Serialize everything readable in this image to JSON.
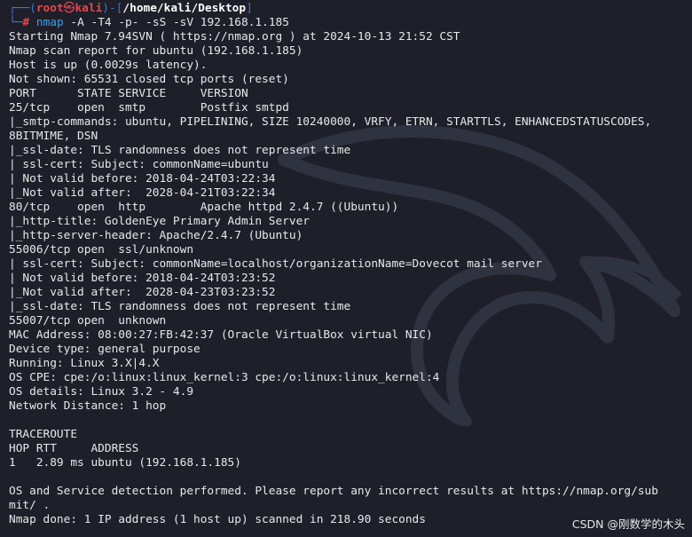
{
  "prompt": {
    "frame_top": "┌──(",
    "user": "root",
    "skull": "㉿",
    "host": "kali",
    "bracket_mid": ")-[",
    "path": "/home/kali/Desktop",
    "bracket_end": "]",
    "frame_bottom": "└─",
    "hash": "#",
    "command": "nmap",
    "args": "-A -T4 -p- -sS -sV 192.168.1.185"
  },
  "output_lines": [
    "Starting Nmap 7.94SVN ( https://nmap.org ) at 2024-10-13 21:52 CST",
    "Nmap scan report for ubuntu (192.168.1.185)",
    "Host is up (0.0029s latency).",
    "Not shown: 65531 closed tcp ports (reset)",
    "PORT      STATE SERVICE     VERSION",
    "25/tcp    open  smtp        Postfix smtpd",
    "|_smtp-commands: ubuntu, PIPELINING, SIZE 10240000, VRFY, ETRN, STARTTLS, ENHANCEDSTATUSCODES,",
    "8BITMIME, DSN",
    "|_ssl-date: TLS randomness does not represent time",
    "| ssl-cert: Subject: commonName=ubuntu",
    "| Not valid before: 2018-04-24T03:22:34",
    "|_Not valid after:  2028-04-21T03:22:34",
    "80/tcp    open  http        Apache httpd 2.4.7 ((Ubuntu))",
    "|_http-title: GoldenEye Primary Admin Server",
    "|_http-server-header: Apache/2.4.7 (Ubuntu)",
    "55006/tcp open  ssl/unknown",
    "| ssl-cert: Subject: commonName=localhost/organizationName=Dovecot mail server",
    "| Not valid before: 2018-04-24T03:23:52",
    "|_Not valid after:  2028-04-23T03:23:52",
    "|_ssl-date: TLS randomness does not represent time",
    "55007/tcp open  unknown",
    "MAC Address: 08:00:27:FB:42:37 (Oracle VirtualBox virtual NIC)",
    "Device type: general purpose",
    "Running: Linux 3.X|4.X",
    "OS CPE: cpe:/o:linux:linux_kernel:3 cpe:/o:linux:linux_kernel:4",
    "OS details: Linux 3.2 - 4.9",
    "Network Distance: 1 hop",
    "",
    "TRACEROUTE",
    "HOP RTT     ADDRESS",
    "1   2.89 ms ubuntu (192.168.1.185)",
    "",
    "OS and Service detection performed. Please report any incorrect results at https://nmap.org/sub",
    "mit/ .",
    "Nmap done: 1 IP address (1 host up) scanned in 218.90 seconds"
  ],
  "watermark": "CSDN @刚数学的木头",
  "colors": {
    "background": "#1e1f29",
    "text": "#e8e8ea",
    "prompt_frame": "#3a78d6",
    "prompt_root": "#e5484d",
    "command": "#3aa0e8"
  },
  "icons": {
    "background_art": "kali-dragon-icon"
  }
}
